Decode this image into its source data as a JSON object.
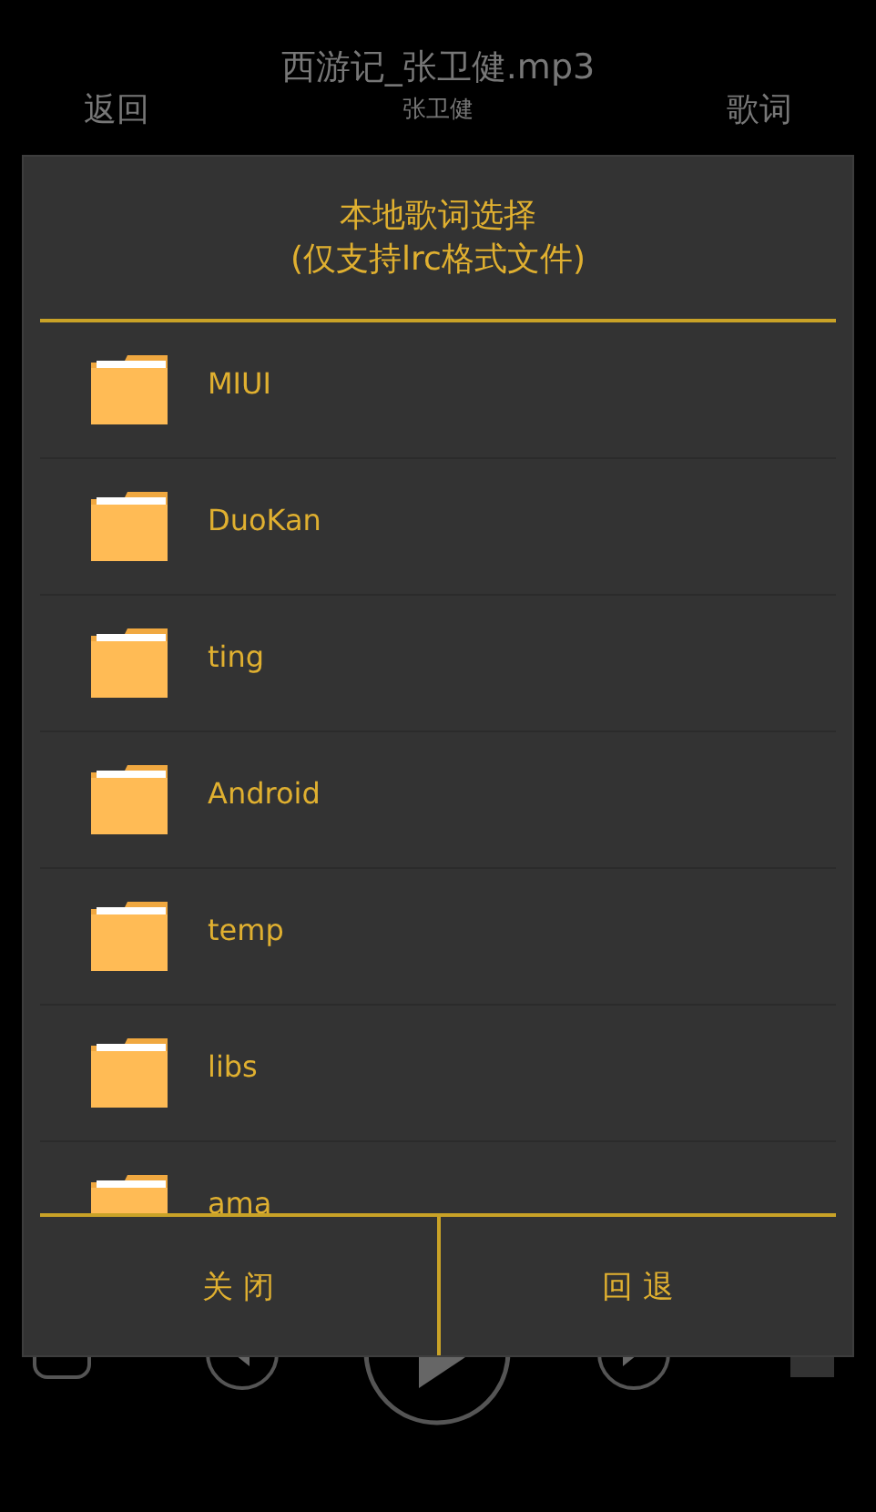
{
  "player": {
    "title": "西游记_张卫健.mp3",
    "artist": "张卫健",
    "back": "返回",
    "lyrics": "歌词"
  },
  "dialog": {
    "title": "本地歌词选择",
    "subtitle": "(仅支持lrc格式文件)",
    "folders": [
      {
        "name": "MIUI"
      },
      {
        "name": "DuoKan"
      },
      {
        "name": "ting"
      },
      {
        "name": "Android"
      },
      {
        "name": "temp"
      },
      {
        "name": "libs"
      },
      {
        "name": "ama"
      }
    ],
    "buttons": [
      "关 闭",
      "回 退"
    ]
  }
}
